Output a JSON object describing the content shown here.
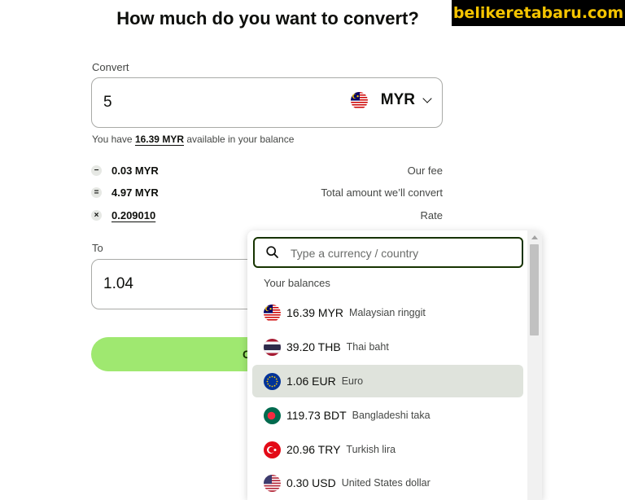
{
  "page": {
    "title": "How much do you want to convert?",
    "watermark": "belikeretabaru.com"
  },
  "convert": {
    "label": "Convert",
    "amount": "5",
    "currency": "MYR",
    "flag_icon": "malaysia-flag-icon"
  },
  "balance": {
    "prefix": "You have ",
    "amount": "16.39 MYR",
    "suffix": " available in your balance"
  },
  "breakdown": [
    {
      "op": "−",
      "value": "0.03 MYR",
      "label": "Our fee"
    },
    {
      "op": "=",
      "value": "4.97 MYR",
      "label": "Total amount we’ll convert"
    },
    {
      "op": "×",
      "value": "0.209010",
      "label": "Rate"
    }
  ],
  "to": {
    "label": "To",
    "amount": "1.04"
  },
  "cta": {
    "label": "C"
  },
  "dropdown": {
    "search_placeholder": "Type a currency / country",
    "section_title": "Your balances",
    "items": [
      {
        "amount": "16.39 MYR",
        "name": "Malaysian ringgit",
        "flag_icon": "malaysia-flag-icon",
        "selected": false
      },
      {
        "amount": "39.20 THB",
        "name": "Thai baht",
        "flag_icon": "thailand-flag-icon",
        "selected": false
      },
      {
        "amount": "1.06 EUR",
        "name": "Euro",
        "flag_icon": "eu-flag-icon",
        "selected": true
      },
      {
        "amount": "119.73 BDT",
        "name": "Bangladeshi taka",
        "flag_icon": "bangladesh-flag-icon",
        "selected": false
      },
      {
        "amount": "20.96 TRY",
        "name": "Turkish lira",
        "flag_icon": "turkey-flag-icon",
        "selected": false
      },
      {
        "amount": "0.30 USD",
        "name": "United States dollar",
        "flag_icon": "usa-flag-icon",
        "selected": false
      }
    ]
  },
  "colors": {
    "accent_green": "#9fe870",
    "dark_green": "#163300",
    "selected_row": "#dfe3dc"
  }
}
